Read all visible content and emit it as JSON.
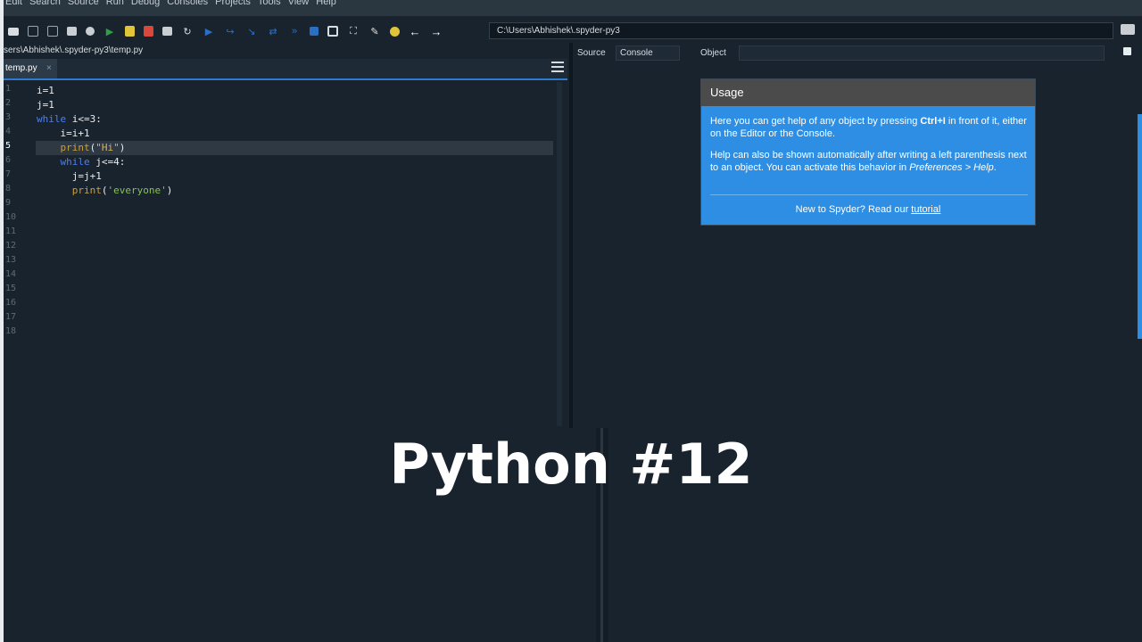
{
  "menu": [
    "Edit",
    "Search",
    "Source",
    "Run",
    "Debug",
    "Consoles",
    "Projects",
    "Tools",
    "View",
    "Help"
  ],
  "toolbar": {
    "path": "C:\\Users\\Abhishek\\.spyder-py3",
    "icons": [
      "open-file-icon",
      "save-icon",
      "save-all-icon",
      "settings-list-icon",
      "new-icon",
      "run-icon",
      "run-cell-icon",
      "run-cell-advance-icon",
      "run-selection-icon",
      "rerun-icon",
      "debug-icon",
      "step-icon",
      "step-into-icon",
      "step-return-icon",
      "continue-icon",
      "stop-icon",
      "maximize-pane-icon",
      "fullscreen-icon",
      "wrench-icon",
      "python-path-icon",
      "back-arrow-icon",
      "forward-arrow-icon"
    ]
  },
  "editor": {
    "file_path": "sers\\Abhishek\\.spyder-py3\\temp.py",
    "tab_label": "temp.py",
    "tab_close": "×",
    "current_line": 5,
    "line_numbers": [
      "1",
      "2",
      "3",
      "4",
      "5",
      "6",
      "7",
      "8",
      "9",
      "10",
      "11",
      "12",
      "13",
      "14",
      "15",
      "16",
      "17",
      "18"
    ],
    "code": {
      "l1": "i=1",
      "l2": "j=1",
      "l3_kw": "while",
      "l3_rest": " i<=3:",
      "l4": "    i=i+1",
      "l5_fn": "    print",
      "l5_open": "(",
      "l5_str": "\"Hi\"",
      "l5_close": ")",
      "l6_kw": "    while",
      "l6_rest": " j<=4:",
      "l7": "      j=j+1",
      "l8_fn": "      print",
      "l8_open": "(",
      "l8_str": "'everyone'",
      "l8_close": ")"
    }
  },
  "help": {
    "source_label": "Source",
    "source_value": "Console",
    "object_label": "Object",
    "usage_title": "Usage",
    "p1_a": "Here you can get help of any object by pressing ",
    "p1_key": "Ctrl+I",
    "p1_b": " in front of it, either on the Editor or the Console.",
    "p2_a": "Help can also be shown automatically after writing a left parenthesis next to an object. You can activate this behavior in ",
    "p2_pref": "Preferences > Help",
    "p2_end": ".",
    "footer_text": "New to Spyder? Read our ",
    "footer_link": "tutorial"
  },
  "overlay_title": "Python #12"
}
